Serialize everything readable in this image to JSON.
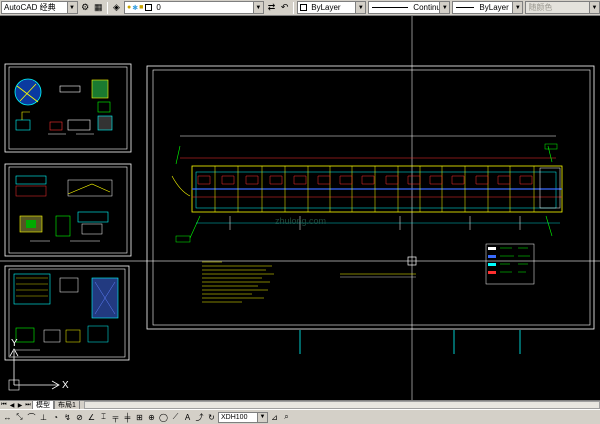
{
  "app": {
    "workspace_label": "AutoCAD 经典"
  },
  "toolbar": {
    "layer_combo_value": "0",
    "color_combo_value": "ByLayer",
    "linetype_combo_value": "Continuous",
    "lineweight_combo_value": "ByLayer",
    "plotstyle_combo_value": "随颜色"
  },
  "canvas": {
    "background_color": "#000000",
    "ucs_x_label": "X",
    "ucs_y_label": "Y",
    "watermark_text": "zhulong.com"
  },
  "layout_tabs": {
    "model_tab": "模型",
    "layout_tab": "布局1"
  },
  "bottom_toolbar": {
    "scale_combo_value": "XDH100"
  },
  "colors": {
    "accent_yellow": "#ffff00",
    "accent_cyan": "#00ffff",
    "accent_green": "#00ff00",
    "accent_red": "#ff3030",
    "accent_blue": "#3a6bff",
    "frame_white": "#ffffff",
    "crosshair": "#c8c8c8"
  },
  "icons": {
    "top": [
      "workspace-settings-icon",
      "layer-properties-icon",
      "layer-state-icon",
      "layer-on-icon",
      "layer-freeze-icon",
      "layer-lock-icon",
      "layer-color-icon",
      "make-current-icon",
      "layer-previous-icon"
    ],
    "bottom": [
      "first-tab-icon",
      "prev-tab-icon",
      "next-tab-icon",
      "last-tab-icon",
      "dimension-icon",
      "arc-icon",
      "circle-icon",
      "radius-icon",
      "angle-icon",
      "quick-dim-icon",
      "baseline-icon",
      "continue-icon",
      "tolerance-icon",
      "center-mark-icon",
      "oblique-icon",
      "text-edit-icon",
      "update-icon",
      "dim-style-icon",
      "zoom-icon"
    ]
  }
}
